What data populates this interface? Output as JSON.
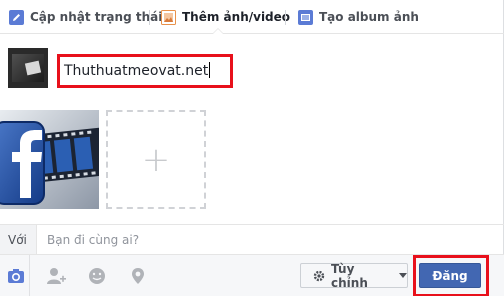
{
  "tabs": [
    {
      "label": "Cập nhật trạng thái",
      "icon": "pencil-icon"
    },
    {
      "label": "Thêm ảnh/video",
      "icon": "photo-icon"
    },
    {
      "label": "Tạo album ảnh",
      "icon": "album-icon"
    }
  ],
  "composer": {
    "text_value": "Thuthuatmeovat.net",
    "add_photo_glyph": "+"
  },
  "with": {
    "label": "Với",
    "placeholder": "Bạn đi cùng ai?"
  },
  "footer": {
    "icons": [
      "camera-icon",
      "tag-friends-icon",
      "feeling-icon",
      "location-icon"
    ],
    "privacy_label": "Tùy chỉnh",
    "post_label": "Đăng"
  },
  "colors": {
    "accent": "#4267b2",
    "highlight": "#e8101b"
  }
}
